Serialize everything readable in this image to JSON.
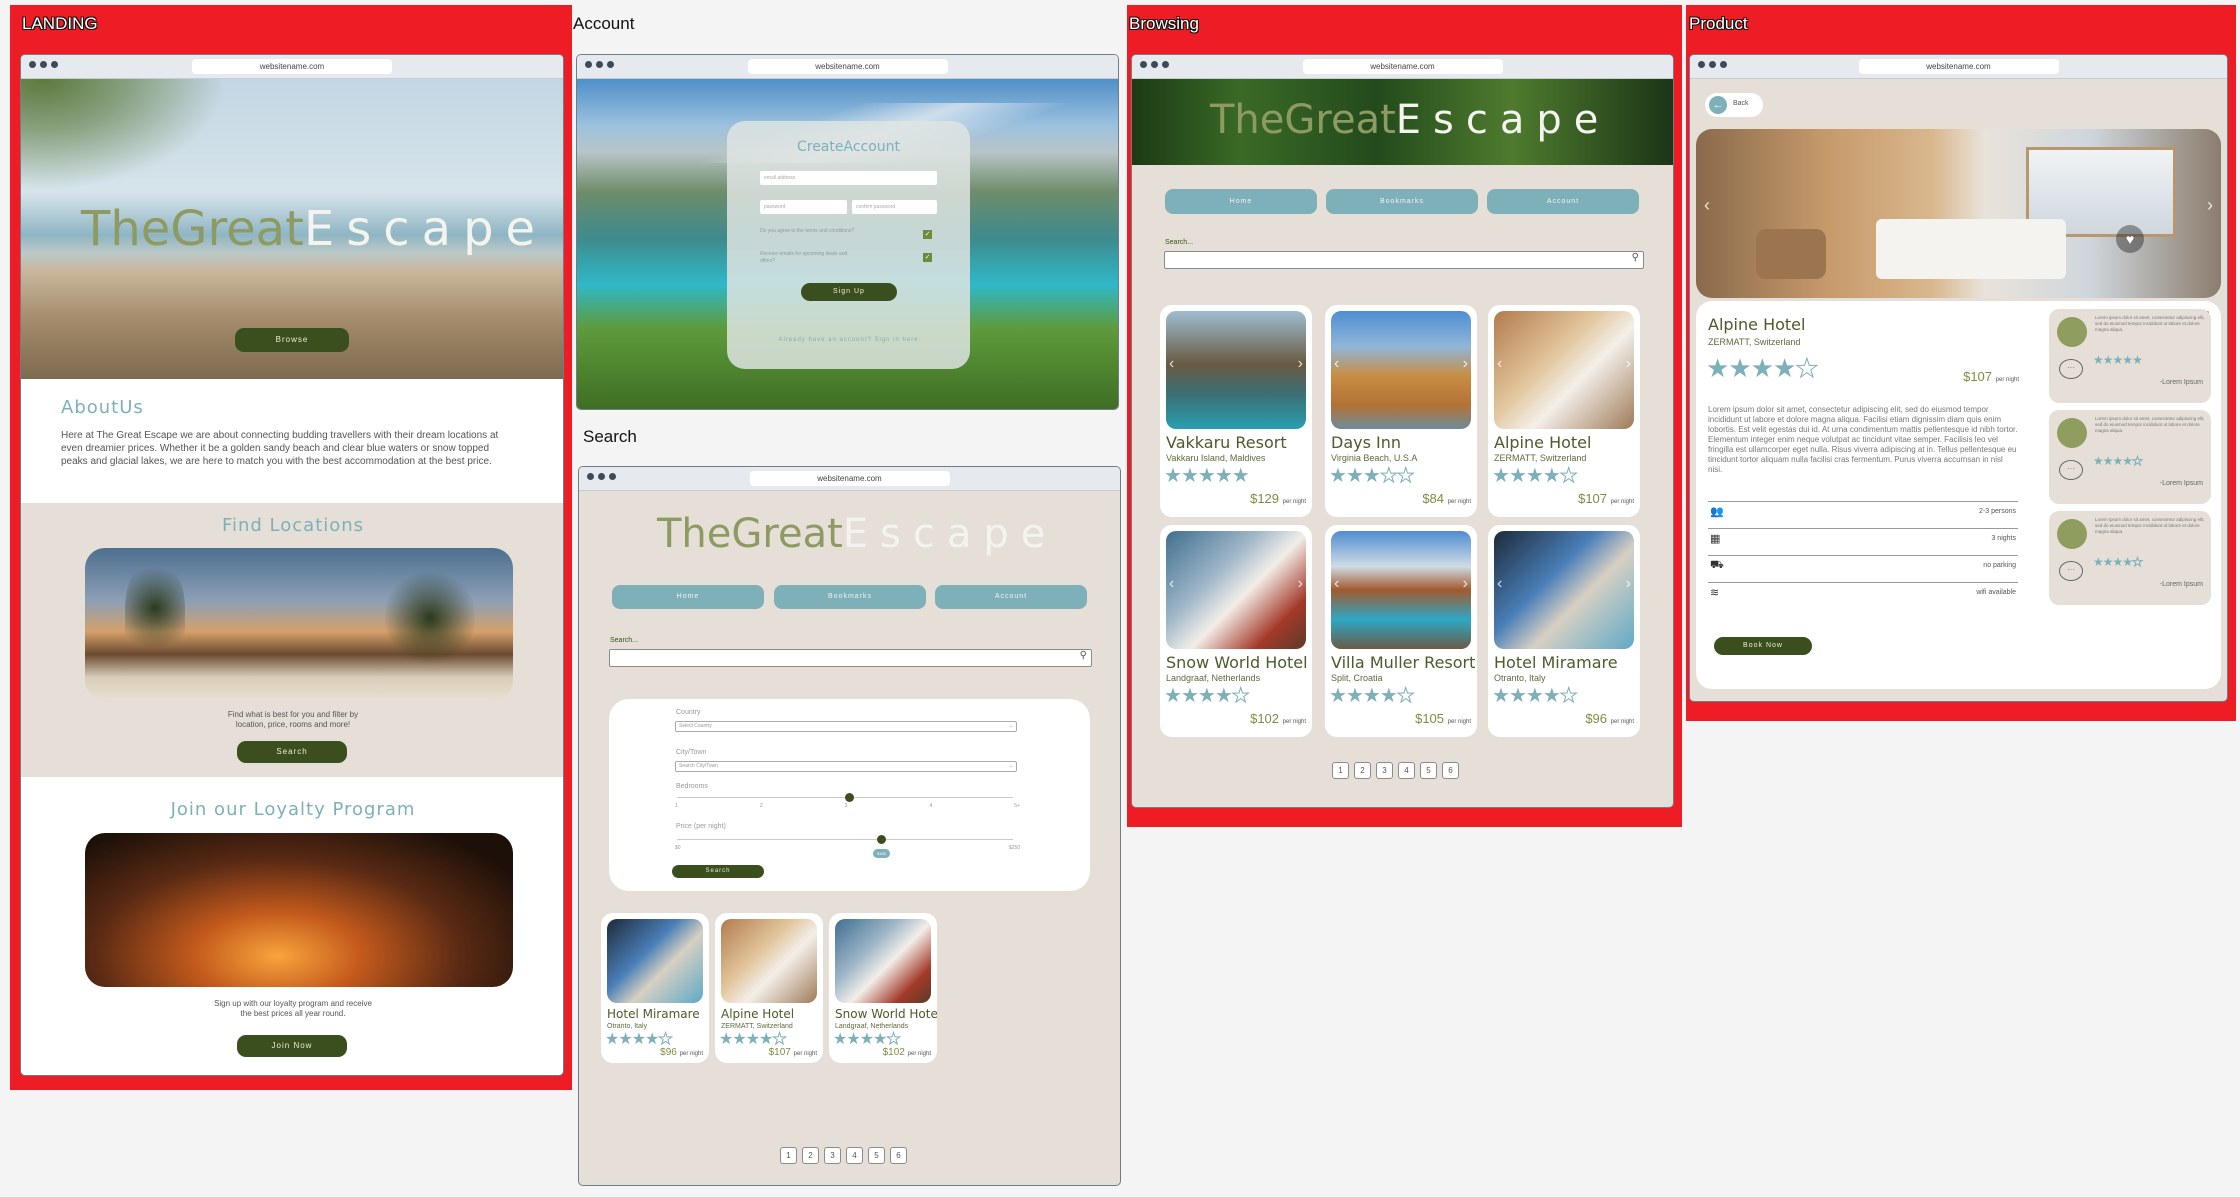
{
  "frames": {
    "landing": "LANDING",
    "account": "Account",
    "search": "Search",
    "browsing": "Browsing",
    "product": "Product"
  },
  "browser": {
    "url": "websitename.com"
  },
  "logo": {
    "part1": "TheGreat",
    "part2": "Escape"
  },
  "landing": {
    "browse_btn": "Browse",
    "about_title": "AboutUs",
    "about_text": "Here at The Great Escape we are about connecting budding travellers with their dream locations at even dreamier prices. Whether it be a golden sandy beach and clear blue waters or snow topped peaks and glacial lakes, we are here to match you with the best accommodation at the best price.",
    "find_title": "Find Locations",
    "find_text": "Find what is best for you and filter by location, price, rooms and more!",
    "search_btn": "Search",
    "loyalty_title": "Join our Loyalty Program",
    "loyalty_text": "Sign up with our loyalty program and receive the best prices all year round.",
    "join_btn": "Join Now"
  },
  "account": {
    "title": "CreateAccount",
    "email_ph": "email address",
    "pass_ph": "password",
    "confirm_ph": "confirm password",
    "check1": "Do you agree to the terms and conditions?",
    "check2": "Receive emails for upcoming deals and offers?",
    "signup_btn": "Sign Up",
    "already": "Already have an account? Sign in here"
  },
  "nav": {
    "home": "Home",
    "bookmarks": "Bookmarks",
    "account": "Account"
  },
  "search": {
    "label": "Search...",
    "country": "Country",
    "country_ph": "Select Country",
    "city": "City/Town",
    "city_ph": "Search City/Town",
    "bedrooms": "Bedrooms",
    "bed_ticks": [
      "1",
      "2",
      "3",
      "4",
      "5+"
    ],
    "price": "Price (per night)",
    "price_min": "$0",
    "price_max": "$250",
    "price_val": "$100",
    "bedrooms_value": 3,
    "search_btn": "Search",
    "results": [
      {
        "name": "Hotel Miramare",
        "loc": "Otranto, Italy",
        "stars": 4,
        "price": "$96"
      },
      {
        "name": "Alpine Hotel",
        "loc": "ZERMATT, Switzerland",
        "stars": 4,
        "price": "$107"
      },
      {
        "name": "Snow World Hotel",
        "loc": "Landgraaf, Netherlands",
        "stars": 4,
        "price": "$102"
      }
    ],
    "pages": [
      "1",
      "2",
      "3",
      "4",
      "5",
      "6"
    ]
  },
  "per_night": "per night",
  "browsing": {
    "cards": [
      {
        "name": "Vakkaru Resort",
        "loc": "Vakkaru Island, Maldives",
        "stars": 5,
        "price": "$129"
      },
      {
        "name": "Days Inn",
        "loc": "Virginia Beach, U.S.A",
        "stars": 3,
        "price": "$84"
      },
      {
        "name": "Alpine Hotel",
        "loc": "ZERMATT, Switzerland",
        "stars": 4,
        "price": "$107"
      },
      {
        "name": "Snow World Hotel",
        "loc": "Landgraaf, Netherlands",
        "stars": 4,
        "price": "$102"
      },
      {
        "name": "Villa Muller Resort",
        "loc": "Split, Croatia",
        "stars": 4,
        "price": "$105"
      },
      {
        "name": "Hotel Miramare",
        "loc": "Otranto, Italy",
        "stars": 4,
        "price": "$96"
      }
    ]
  },
  "product": {
    "back": "Back",
    "name": "Alpine Hotel",
    "loc": "ZERMATT, Switzerland",
    "stars": 4,
    "price": "$107",
    "desc": "Lorem ipsum dolor sit amet, consectetur adipiscing elit, sed do eiusmod tempor incididunt ut labore et dolore magna aliqua. Facilisi etiam dignissim diam quis enim lobortis. Est velit egestas dui id. At urna condimentum mattis pellentesque id nibh tortor. Elementum integer enim neque volutpat ac tincidunt vitae semper. Facilisis leo vel fringilla est ullamcorper eget nulla. Risus viverra adipiscing at in. Tellus pellentesque eu tincidunt tortor aliquam nulla facilisi cras fermentum. Purus viverra accumsan in nisl nisi.",
    "features": [
      {
        "icon": "people-icon",
        "text": "2-3 persons"
      },
      {
        "icon": "calendar-icon",
        "text": "3 nights"
      },
      {
        "icon": "car-icon",
        "text": "no parking"
      },
      {
        "icon": "wifi-icon",
        "text": "wifi available"
      }
    ],
    "book_btn": "Book Now",
    "review_text": "Lorem ipsum dolor sit amet, consectetur adipiscing elit, sed do eiusmod tempor incididunt ut labore et dolore magna aliqua.",
    "reviewer": "-Lorem Ipsum",
    "review_stars": [
      5,
      4,
      4
    ]
  },
  "colors": {
    "red": "#ee1c25",
    "teal": "#7eb0b9",
    "olive": "#3b4f1e",
    "beige": "#e5dfd7"
  }
}
